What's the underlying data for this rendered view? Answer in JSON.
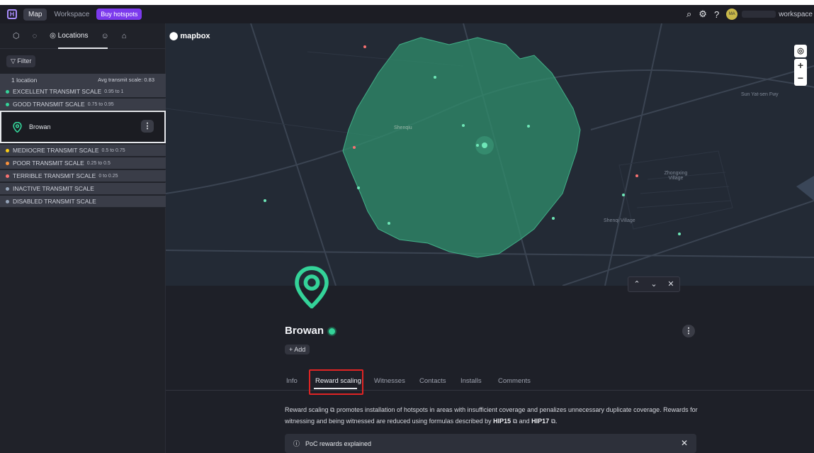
{
  "topbar": {
    "logo": "H",
    "map_label": "Map",
    "workspace_label": "Workspace",
    "buy_label": "Buy hotspots",
    "avatar_initials": "MA",
    "workspace_suffix": "workspace"
  },
  "sidebar": {
    "locations_tab": "Locations",
    "filter_label": "Filter",
    "summary": {
      "count": "1 location",
      "avg": "Avg transmit scale: 0.83"
    },
    "scale_rows_top": [
      {
        "label": "EXCELLENT TRANSMIT SCALE",
        "range": "0.95 to 1",
        "color": "#34d399"
      },
      {
        "label": "GOOD TRANSMIT SCALE",
        "range": "0.75 to 0.95",
        "color": "#34d399"
      }
    ],
    "selected_location": "Browan",
    "scale_rows_bottom": [
      {
        "label": "MEDIOCRE TRANSMIT SCALE",
        "range": "0.5 to 0.75",
        "color": "#facc15"
      },
      {
        "label": "POOR TRANSMIT SCALE",
        "range": "0.25 to 0.5",
        "color": "#fb923c"
      },
      {
        "label": "TERRIBLE TRANSMIT SCALE",
        "range": "0 to 0.25",
        "color": "#f87171"
      },
      {
        "label": "INACTIVE TRANSMIT SCALE",
        "range": "",
        "color": "#94a3b8"
      },
      {
        "label": "DISABLED TRANSMIT SCALE",
        "range": "",
        "color": "#94a3b8"
      }
    ]
  },
  "map": {
    "attribution": "mapbox",
    "labels": [
      "Shenqiu",
      "Sun Yat-sen Fwy",
      "Zhongxing Village",
      "Shenqi Village"
    ]
  },
  "detail": {
    "title": "Browan",
    "add_label": "+ Add",
    "tabs": [
      "Info",
      "Reward scaling",
      "Witnesses",
      "Contacts",
      "Installs",
      "Comments"
    ],
    "active_tab": "Reward scaling",
    "description_lead": "Reward scaling",
    "description_body": " promotes installation of hotspots in areas with insufficient coverage and penalizes unnecessary duplicate coverage. Rewards for witnessing and being witnessed are reduced using formulas described by ",
    "hip15": "HIP15",
    "and_text": " and ",
    "hip17": "HIP17",
    "poc_label": "PoC rewards explained"
  }
}
